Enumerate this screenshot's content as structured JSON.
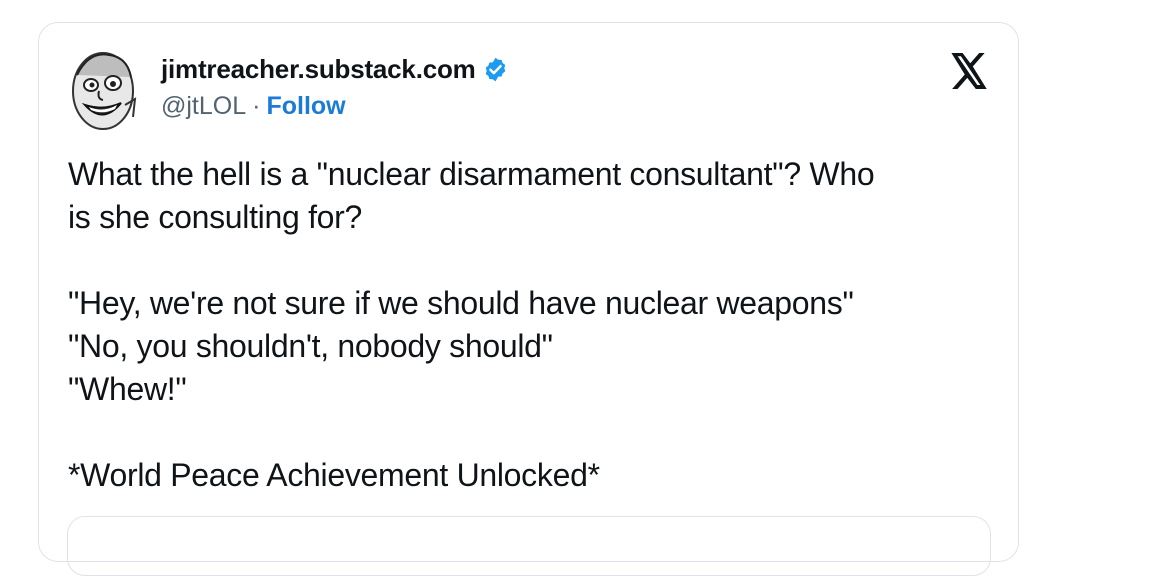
{
  "author": {
    "display_name": "jimtreacher.substack.com",
    "handle": "@jtLOL",
    "separator": "·",
    "follow_label": "Follow",
    "verified_color": "#1d9bf0"
  },
  "brand": {
    "logo_icon": "x-logo-icon"
  },
  "tweet": {
    "lines": [
      "What the hell is a \"nuclear disarmament consultant\"? Who",
      "is she consulting for?",
      "\"Hey, we're not sure if we should have nuclear weapons\"",
      "\"No, you shouldn't, nobody should\"",
      "\"Whew!\"",
      "*World Peace Achievement Unlocked*"
    ]
  },
  "colors": {
    "text": "#0f1419",
    "secondary": "#536471",
    "link": "#1d7bd8",
    "border": "#dfe3e8"
  }
}
